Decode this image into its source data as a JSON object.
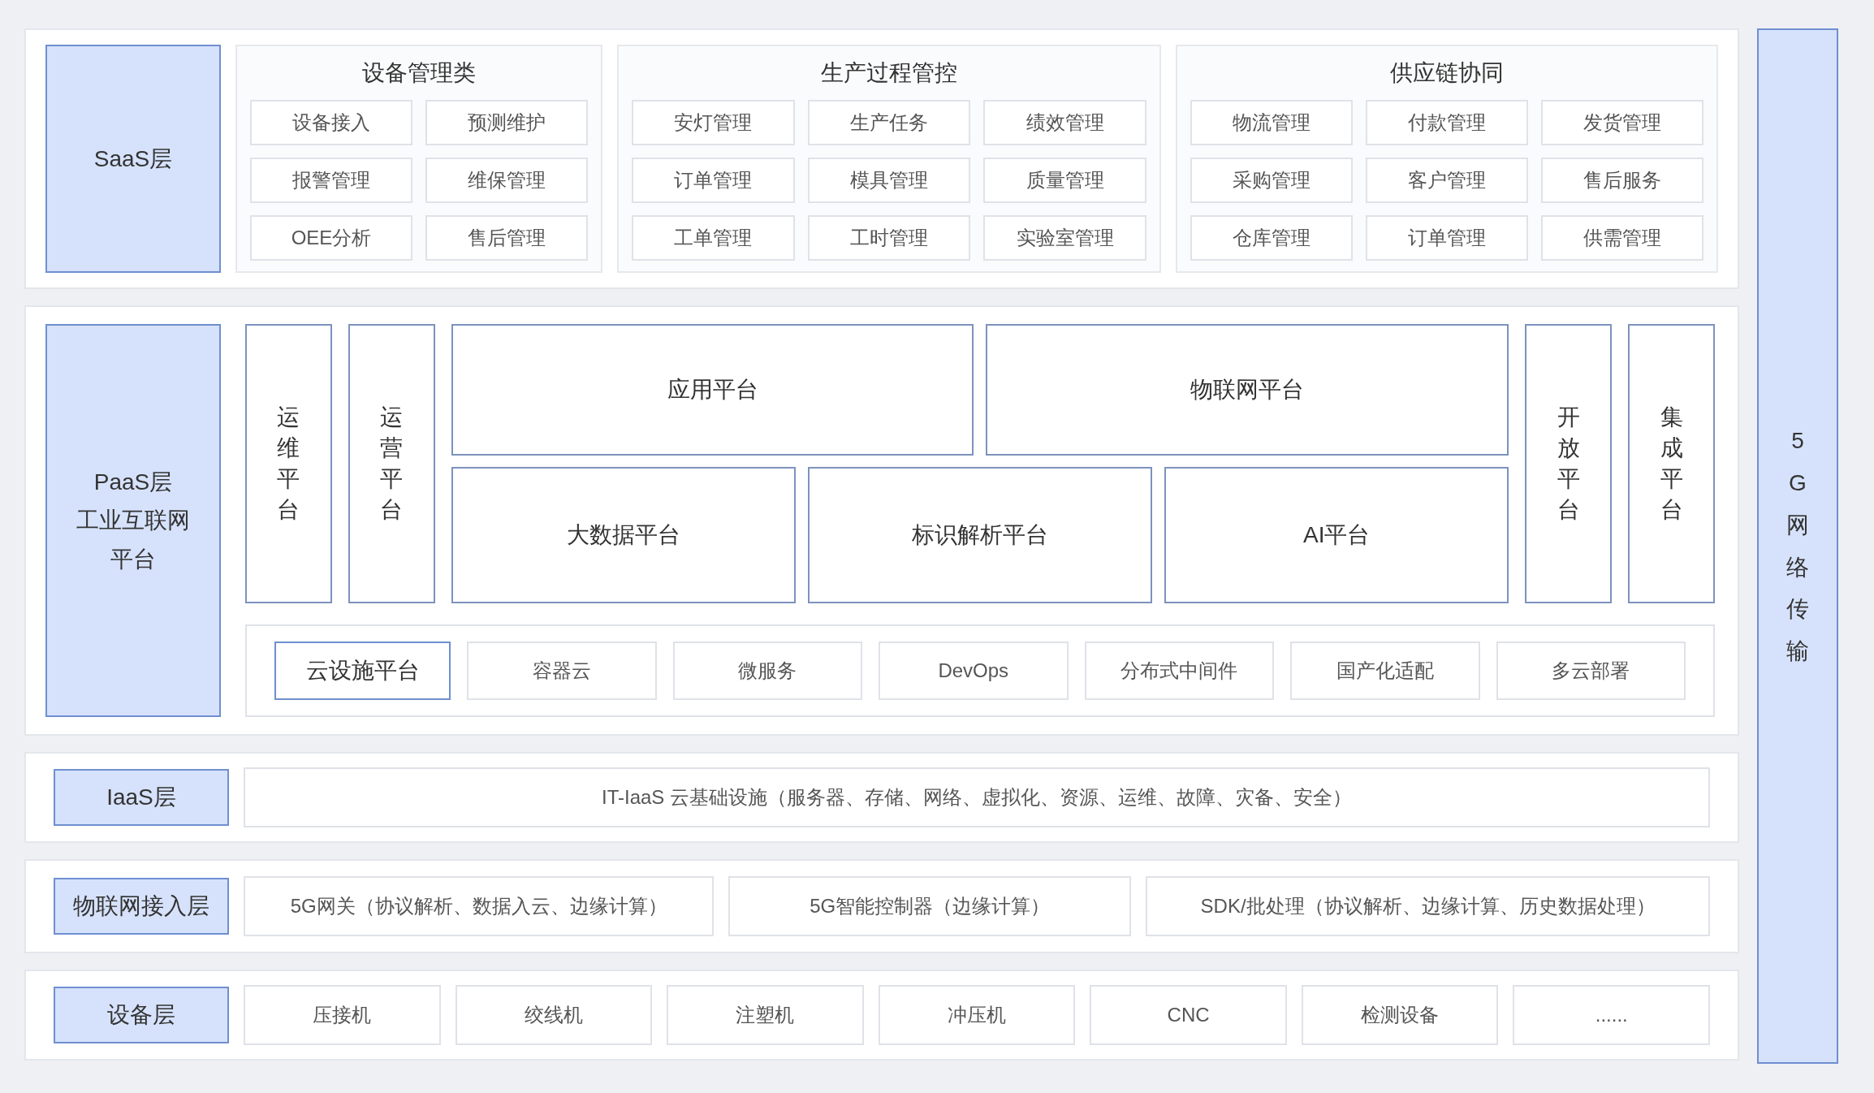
{
  "saas": {
    "label": "SaaS层",
    "groups": [
      {
        "title": "设备管理类",
        "items": [
          "设备接入",
          "预测维护",
          "报警管理",
          "维保管理",
          "OEE分析",
          "售后管理"
        ]
      },
      {
        "title": "生产过程管控",
        "items": [
          "安灯管理",
          "生产任务",
          "绩效管理",
          "订单管理",
          "模具管理",
          "质量管理",
          "工单管理",
          "工时管理",
          "实验室管理"
        ]
      },
      {
        "title": "供应链协同",
        "items": [
          "物流管理",
          "付款管理",
          "发货管理",
          "采购管理",
          "客户管理",
          "售后服务",
          "仓库管理",
          "订单管理",
          "供需管理"
        ]
      }
    ]
  },
  "paas": {
    "label_lines": [
      "PaaS层",
      "工业互联网",
      "平台"
    ],
    "left_platforms": [
      "运维平台",
      "运营平台"
    ],
    "top_platforms": [
      "应用平台",
      "物联网平台"
    ],
    "bottom_platforms": [
      "大数据平台",
      "标识解析平台",
      "AI平台"
    ],
    "right_platforms": [
      "开放平台",
      "集成平台"
    ],
    "cloud": {
      "title": "云设施平台",
      "items": [
        "容器云",
        "微服务",
        "DevOps",
        "分布式中间件",
        "国产化适配",
        "多云部署"
      ]
    }
  },
  "iaas": {
    "label": "IaaS层",
    "content": "IT-IaaS 云基础设施（服务器、存储、网络、虚拟化、资源、运维、故障、灾备、安全）"
  },
  "iot": {
    "label": "物联网接入层",
    "items": [
      "5G网关（协议解析、数据入云、边缘计算）",
      "5G智能控制器（边缘计算）",
      "SDK/批处理（协议解析、边缘计算、历史数据处理）"
    ]
  },
  "device": {
    "label": "设备层",
    "items": [
      "压接机",
      "绞线机",
      "注塑机",
      "冲压机",
      "CNC",
      "检测设备",
      "......"
    ]
  },
  "network": {
    "label": "5G网络传输"
  }
}
